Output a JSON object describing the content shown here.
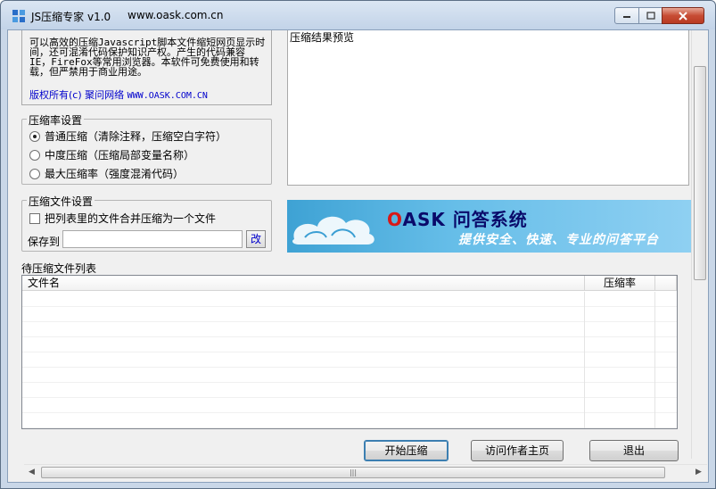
{
  "window": {
    "title": "JS压缩专家 v1.0",
    "url": "www.oask.com.cn"
  },
  "intro": {
    "text": "可以高效的压缩Javascript脚本文件缩短网页显示时间，还可混淆代码保护知识产权。产生的代码兼容IE，FireFox等常用浏览器。本软件可免费使用和转载，但严禁用于商业用途。",
    "copyright": "版权所有(c) 聚问网络",
    "copyright_url": "WWW.OASK.COM.CN"
  },
  "compression": {
    "title": "压缩率设置",
    "options": [
      {
        "label": "普通压缩（清除注释，压缩空白字符）",
        "checked": true
      },
      {
        "label": "中度压缩（压缩局部变量名称）",
        "checked": false
      },
      {
        "label": "最大压缩率（强度混淆代码）",
        "checked": false
      }
    ]
  },
  "file_settings": {
    "title": "压缩文件设置",
    "merge_label": "把列表里的文件合并压缩为一个文件",
    "merge_checked": false,
    "save_to_label": "保存到",
    "save_to_value": "",
    "change_button": "改"
  },
  "preview": {
    "label": "压缩结果预览"
  },
  "banner": {
    "title_o": "O",
    "title_rest": "ASK 问答系统",
    "subtitle": "提供安全、快速、专业的问答平台"
  },
  "file_list": {
    "label": "待压缩文件列表",
    "columns": [
      "文件名",
      "压缩率",
      ""
    ],
    "rows": []
  },
  "buttons": {
    "start": "开始压缩",
    "visit": "访问作者主页",
    "exit": "退出"
  },
  "colors": {
    "link": "#0000cc",
    "banner_bg": "#4fb0e0",
    "close_btn": "#c74c34"
  }
}
